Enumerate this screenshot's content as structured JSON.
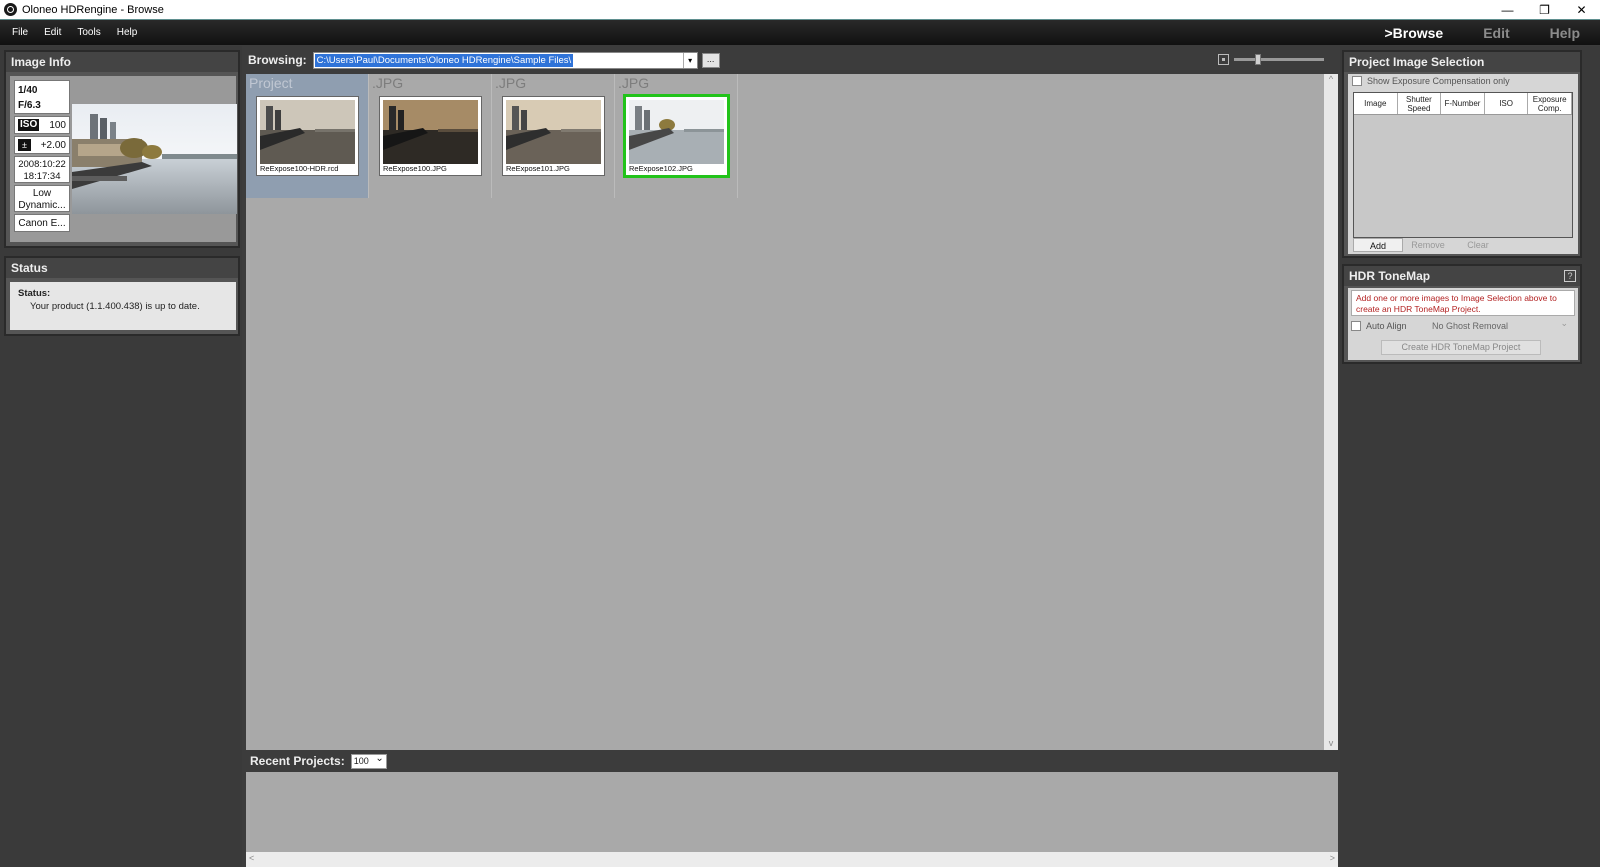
{
  "window": {
    "title": "Oloneo HDRengine - Browse",
    "controls": {
      "minimize": "—",
      "restore": "❐",
      "close": "✕"
    }
  },
  "menu": [
    "File",
    "Edit",
    "Tools",
    "Help"
  ],
  "modes": [
    {
      "label": ">Browse",
      "active": true
    },
    {
      "label": "Edit",
      "active": false
    },
    {
      "label": "Help",
      "active": false
    }
  ],
  "image_info": {
    "title": "Image Info",
    "shutter": "1/40",
    "aperture": "F/6.3",
    "iso_icon": "ISO",
    "iso": "100",
    "exposure_icon": "±",
    "exposure": "+2.00",
    "date": "2008:10:22",
    "time": "18:17:34",
    "dynamic_range": "Low Dynamic...",
    "camera": "Canon E..."
  },
  "status": {
    "title": "Status",
    "label": "Status:",
    "message": "Your product (1.1.400.438) is up to date."
  },
  "browse": {
    "label": "Browsing:",
    "path": "C:\\Users\\Paul\\Documents\\Oloneo HDRengine\\Sample Files\\",
    "dropdown_glyph": "▾",
    "browse_button": "...",
    "zoom_level": 0.25
  },
  "thumbnails": [
    {
      "ext": "Project",
      "name": "ReExpose100-HDR.rcd",
      "selected": true,
      "highlight": false
    },
    {
      "ext": ".JPG",
      "name": "ReExpose100.JPG",
      "selected": false,
      "highlight": false
    },
    {
      "ext": ".JPG",
      "name": "ReExpose101.JPG",
      "selected": false,
      "highlight": false
    },
    {
      "ext": ".JPG",
      "name": "ReExpose102.JPG",
      "selected": false,
      "highlight": true
    }
  ],
  "recent": {
    "label": "Recent Projects:",
    "count": "100"
  },
  "scroll": {
    "up": "^",
    "down": "v",
    "left": "<",
    "right": ">"
  },
  "project_selection": {
    "title": "Project Image Selection",
    "show_exposure_only": "Show Exposure Compensation only",
    "columns": [
      "Image",
      "Shutter Speed",
      "F-Number",
      "ISO",
      "Exposure Comp."
    ],
    "buttons": {
      "add": "Add",
      "remove": "Remove",
      "clear": "Clear"
    }
  },
  "hdr_tonemap": {
    "title": "HDR ToneMap",
    "help": "?",
    "message": "Add one or more images to Image Selection above to create an HDR ToneMap Project.",
    "auto_align": "Auto Align",
    "ghost": "No Ghost Removal",
    "create_button": "Create HDR ToneMap Project"
  },
  "colors": {
    "highlight_border": "#22c31a",
    "selected_cell": "#8f9eb0",
    "path_highlight": "#2f73d8",
    "warning_text": "#b32222"
  }
}
